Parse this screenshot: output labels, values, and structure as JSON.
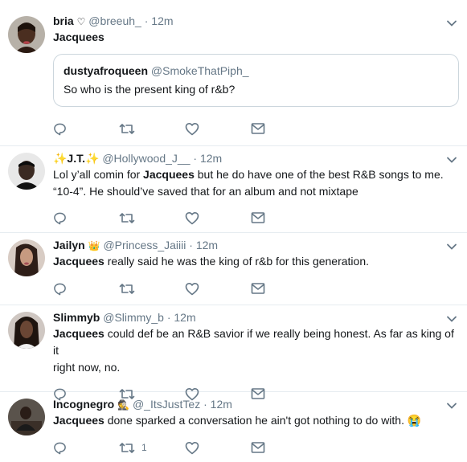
{
  "tweets": [
    {
      "name": "bria",
      "badge": "♡",
      "handle": "@breeuh_",
      "time": "12m",
      "mention": "Jacquees",
      "text_rest": "",
      "quote": {
        "name": "dustyafroqueen",
        "handle": "@SmokeThatPiph_",
        "text": "So who is the present king of r&b?"
      },
      "reply_count": ""
    },
    {
      "name_prefix": "✨J.T.✨",
      "handle": "@Hollywood_J__",
      "time": "12m",
      "text_before": "Lol y’all comin for ",
      "mention": "Jacquees",
      "text_after": " but he do have one of the best R&B songs to me.",
      "text_line2": "“10-4”. He should’ve saved that for an album and not mixtape",
      "reply_count": ""
    },
    {
      "name": "Jailyn",
      "badge": "👑",
      "handle": "@Princess_Jaiiii",
      "time": "12m",
      "mention": "Jacquees",
      "text_rest": " really said he was the king of r&b for this generation.",
      "reply_count": ""
    },
    {
      "name": "Slimmyb",
      "handle": "@Slimmy_b",
      "time": "12m",
      "mention": "Jacquees",
      "text_rest": " could def be an R&B savior if we really being honest. As far as king of it",
      "text_line2": "right now, no.",
      "reply_count": ""
    },
    {
      "name": "Incognegro",
      "badge": "🕵",
      "handle": "@_ItsJustTez",
      "time": "12m",
      "mention": "Jacquees",
      "text_rest": " done sparked a conversation he ain't got nothing to do with. 😭",
      "retweet_count": "1"
    }
  ],
  "separator": "·",
  "icons": {
    "reply": "reply-icon",
    "retweet": "retweet-icon",
    "like": "like-icon",
    "dm": "direct-message-icon",
    "menu": "chevron-down-icon"
  },
  "colors": {
    "text": "#14171a",
    "muted": "#657786",
    "border": "#e6ecf0"
  }
}
